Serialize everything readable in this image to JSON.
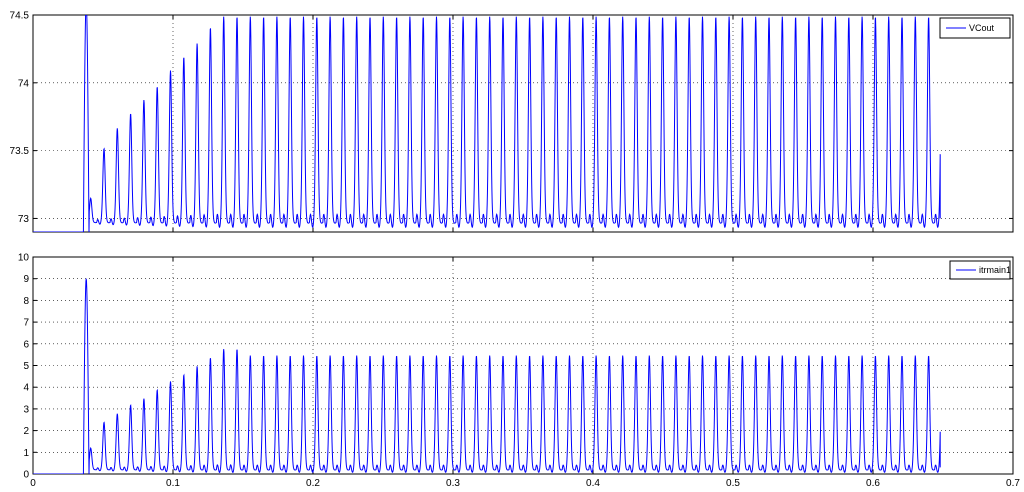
{
  "chart_data": [
    {
      "type": "line",
      "title": "",
      "xlabel": "",
      "ylabel": "",
      "xlim": [
        0,
        0.7
      ],
      "ylim": [
        72.9,
        74.5
      ],
      "xticks": [
        0,
        0.1,
        0.2,
        0.3,
        0.4,
        0.5,
        0.6,
        0.7
      ],
      "xtick_labels": [
        "0",
        "0.1",
        "0.2",
        "0.3",
        "0.4",
        "0.5",
        "0.6",
        "0.7"
      ],
      "yticks": [
        73,
        73.5,
        74,
        74.5
      ],
      "ytick_labels": [
        "73",
        "73.5",
        "74",
        "74.5"
      ],
      "show_xtick_labels": false,
      "grid": true,
      "legend_position": "top-right",
      "color": "#0000ff",
      "series": [
        {
          "name": "VCout",
          "start_time": 0.036,
          "end_time": 0.648,
          "period": 0.0095,
          "initial_spike_peak": 74.6,
          "baseline_before_start": 72.9,
          "peaks": [
            [
              0.046,
              73.15
            ],
            [
              0.055,
              73.52
            ],
            [
              0.065,
              73.67
            ],
            [
              0.074,
              73.78
            ],
            [
              0.084,
              73.88
            ],
            [
              0.093,
              73.98
            ],
            [
              0.103,
              74.1
            ],
            [
              0.112,
              74.2
            ],
            [
              0.122,
              74.3
            ],
            [
              0.131,
              74.42
            ],
            [
              0.141,
              74.5
            ]
          ],
          "steady_peak": 74.5,
          "steady_trough": 72.97
        }
      ]
    },
    {
      "type": "line",
      "title": "",
      "xlabel": "",
      "ylabel": "",
      "xlim": [
        0,
        0.7
      ],
      "ylim": [
        0,
        10
      ],
      "xticks": [
        0,
        0.1,
        0.2,
        0.3,
        0.4,
        0.5,
        0.6,
        0.7
      ],
      "xtick_labels": [
        "0",
        "0.1",
        "0.2",
        "0.3",
        "0.4",
        "0.5",
        "0.6",
        "0.7"
      ],
      "yticks": [
        0,
        1,
        2,
        3,
        4,
        5,
        6,
        7,
        8,
        9,
        10
      ],
      "ytick_labels": [
        "0",
        "1",
        "2",
        "3",
        "4",
        "5",
        "6",
        "7",
        "8",
        "9",
        "10"
      ],
      "show_xtick_labels": true,
      "grid": true,
      "legend_position": "top-right",
      "color": "#0000ff",
      "series": [
        {
          "name": "itrmain1",
          "start_time": 0.036,
          "end_time": 0.648,
          "period": 0.0095,
          "initial_spike_peak": 9.0,
          "baseline_before_start": 0,
          "peaks": [
            [
              0.046,
              1.2
            ],
            [
              0.055,
              2.4
            ],
            [
              0.065,
              2.8
            ],
            [
              0.074,
              3.2
            ],
            [
              0.084,
              3.5
            ],
            [
              0.093,
              3.9
            ],
            [
              0.103,
              4.3
            ],
            [
              0.112,
              4.6
            ],
            [
              0.122,
              5.0
            ],
            [
              0.131,
              5.4
            ],
            [
              0.141,
              5.8
            ]
          ],
          "steady_peak": 5.5,
          "steady_trough": 0.2
        }
      ]
    }
  ]
}
